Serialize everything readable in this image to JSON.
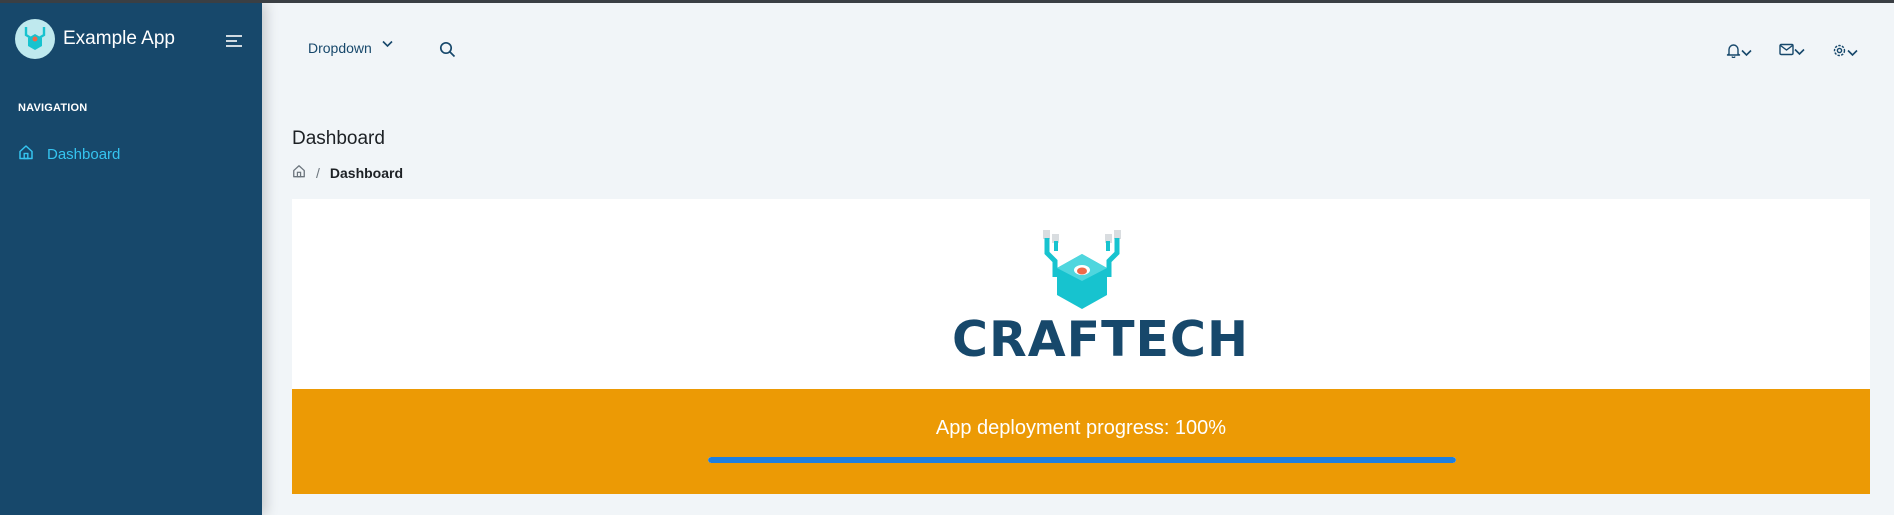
{
  "app": {
    "name": "Example App"
  },
  "sidebar": {
    "heading": "NAVIGATION",
    "items": [
      {
        "label": "Dashboard",
        "icon": "home-icon",
        "active": true
      }
    ]
  },
  "header": {
    "dropdown_label": "Dropdown",
    "icons": [
      "bell-icon",
      "mail-icon",
      "gear-icon"
    ]
  },
  "page": {
    "title": "Dashboard",
    "breadcrumb": {
      "current": "Dashboard"
    }
  },
  "logo_card": {
    "wordmark": "CRAFTECH"
  },
  "progress": {
    "text": "App deployment progress: 100%",
    "percent": 100
  },
  "colors": {
    "sidebar_bg": "#17486b",
    "accent": "#35c4f0",
    "progress_card": "#ec9a05",
    "progress_fill": "#1d7fe0",
    "brand_teal": "#17c3cf"
  }
}
